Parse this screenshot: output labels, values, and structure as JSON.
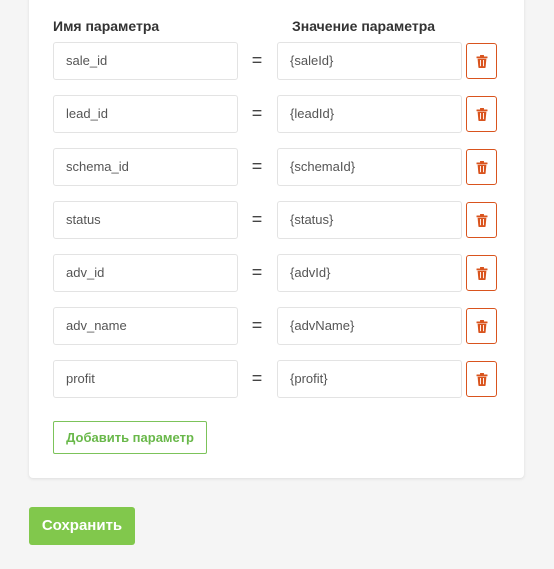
{
  "headers": {
    "name": "Имя параметра",
    "value": "Значение параметра"
  },
  "params": [
    {
      "name": "sale_id",
      "value": "{saleId}"
    },
    {
      "name": "lead_id",
      "value": "{leadId}"
    },
    {
      "name": "schema_id",
      "value": "{schemaId}"
    },
    {
      "name": "status",
      "value": "{status}"
    },
    {
      "name": "adv_id",
      "value": "{advId}"
    },
    {
      "name": "adv_name",
      "value": "{advName}"
    },
    {
      "name": "profit",
      "value": "{profit}"
    }
  ],
  "equals_sign": "=",
  "delete_icon": "trash-icon",
  "add_button_label": "Добавить параметр",
  "save_button_label": "Сохранить",
  "colors": {
    "accent_green": "#81c84c",
    "add_green": "#69b84a",
    "delete_orange": "#d9541e"
  }
}
